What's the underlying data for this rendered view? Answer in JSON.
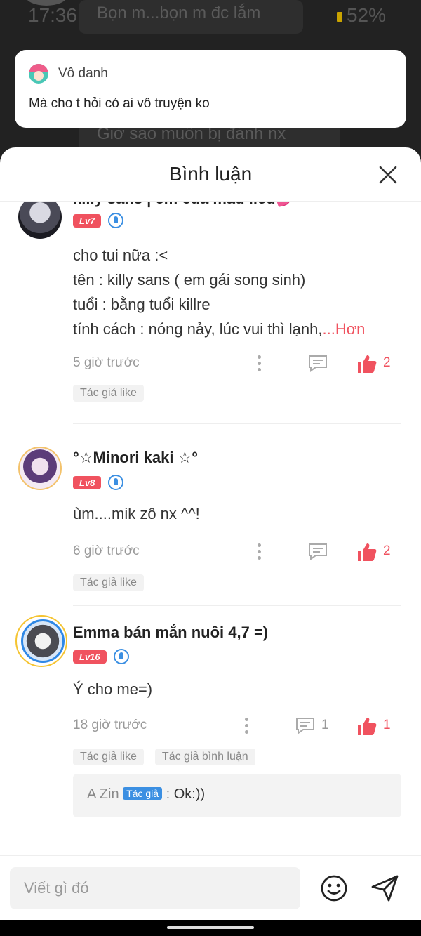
{
  "status_bar": {
    "time": "17:36",
    "battery": "52%"
  },
  "background_chat": {
    "bubble_top": "Bọn m...bọn m đc lắm",
    "bubble_bottom": "Giờ sao muốn bị đánh nx"
  },
  "notification": {
    "sender": "Vô danh",
    "message": "Mà cho t hỏi có ai vô truyện ko"
  },
  "sheet": {
    "title": "Bình luận"
  },
  "comments": [
    {
      "name": "killy sans | em của màu liều💕",
      "level": "Lv7",
      "lines": [
        "cho tui nữa :<",
        "tên : killy sans ( em gái song sinh)",
        "tuổi : bằng tuổi killre",
        "tính cách : nóng nảy, lúc vui thì lạnh,"
      ],
      "more_label": "...Hơn",
      "time": "5 giờ trước",
      "reply_count": "",
      "like_count": "2",
      "tags": [
        "Tác giả like"
      ]
    },
    {
      "name": "°☆Minori kaki ☆°",
      "level": "Lv8",
      "lines": [
        "ùm....mik zô nx ^^!"
      ],
      "time": "6 giờ trước",
      "reply_count": "",
      "like_count": "2",
      "tags": [
        "Tác giả like"
      ]
    },
    {
      "name": "Emma bán mắn nuôi 4,7 =)",
      "level": "Lv16",
      "lines": [
        "Ý cho me=)"
      ],
      "time": "18 giờ trước",
      "reply_count": "1",
      "like_count": "1",
      "tags": [
        "Tác giả like",
        "Tác giả bình luận"
      ],
      "reply": {
        "author": "A Zin",
        "author_badge": "Tác giả",
        "separator": " : ",
        "text": "Ok:))"
      }
    }
  ],
  "input": {
    "placeholder": "Viết gì đó"
  },
  "colors": {
    "accent": "#f0525f",
    "badge_blue": "#3b8fe2"
  }
}
